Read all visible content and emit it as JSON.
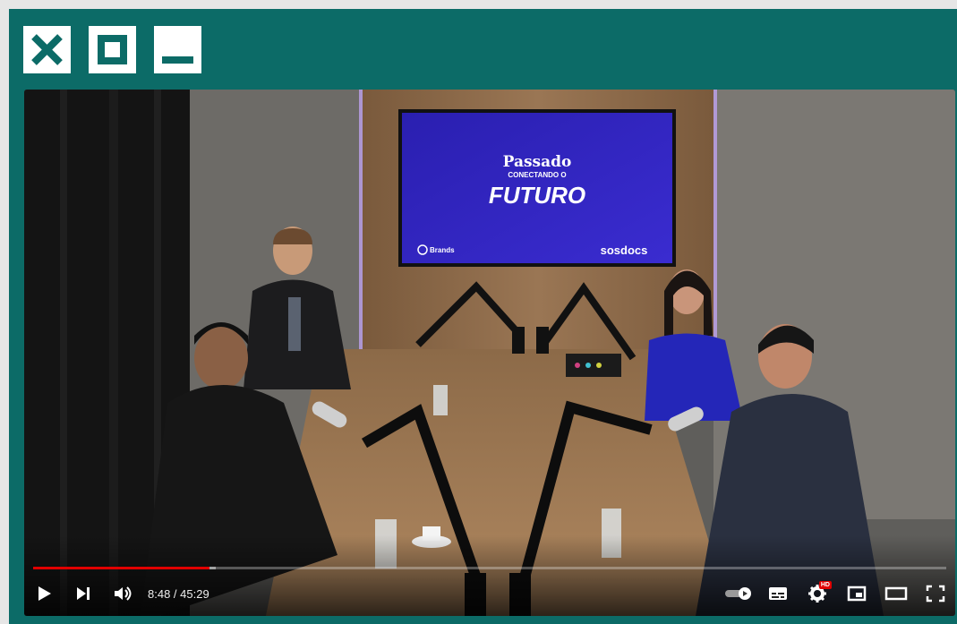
{
  "window": {
    "close_icon": "close-icon",
    "maximize_icon": "maximize-icon",
    "minimize_icon": "minimize-icon",
    "frame_color": "#0c6b67"
  },
  "video": {
    "screen": {
      "title_line1": "Passado",
      "title_line2": "CONECTANDO O",
      "title_line3": "FUTURO",
      "logo_left": "Brands",
      "logo_right": "sosdocs"
    }
  },
  "player": {
    "current_time": "8:48",
    "separator": " / ",
    "duration": "45:29",
    "progress": 0.193,
    "buffered": 0.2,
    "hd_badge": "HD",
    "accent_color": "#e00000",
    "icons": {
      "play": "play-icon",
      "next": "next-icon",
      "volume": "volume-icon",
      "autoplay": "autoplay-toggle-icon",
      "subtitles": "subtitles-icon",
      "settings": "settings-icon",
      "miniplayer": "miniplayer-icon",
      "theater": "theater-icon",
      "fullscreen": "fullscreen-icon"
    }
  }
}
